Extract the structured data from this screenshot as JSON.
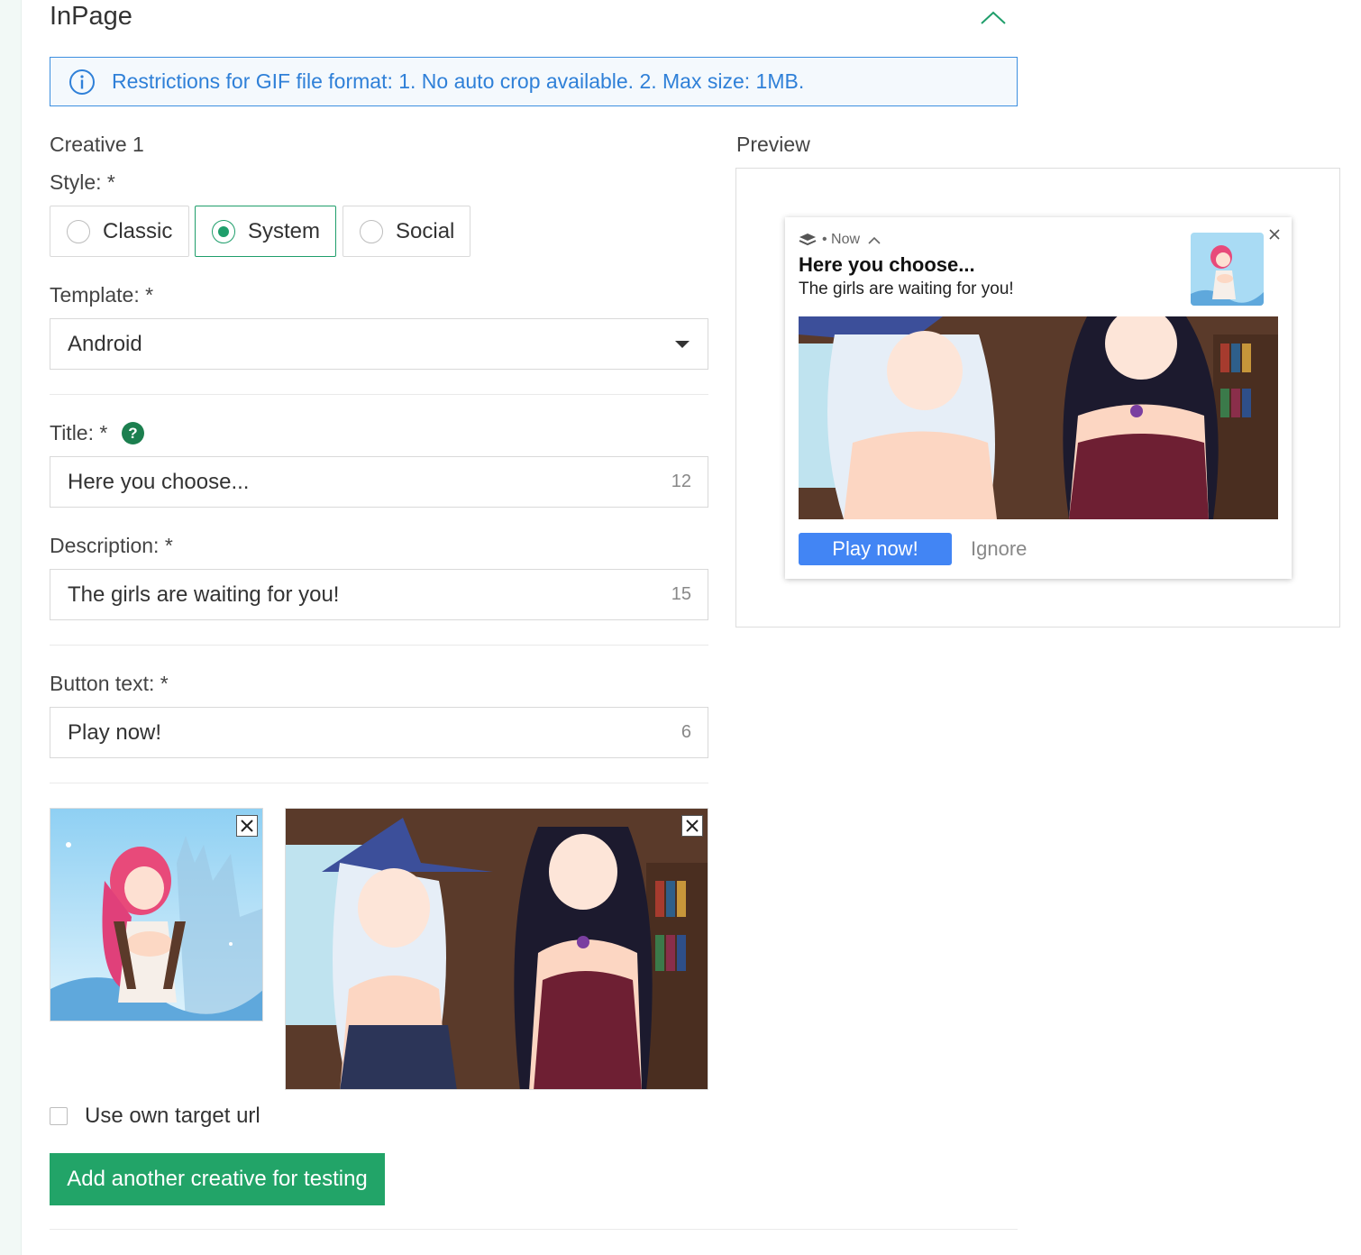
{
  "section": {
    "title": "InPage",
    "collapse_icon": "chevron-up-icon"
  },
  "info": {
    "icon": "info-circle-icon",
    "text": "Restrictions for GIF file format: 1. No auto crop available. 2. Max size: 1MB."
  },
  "creative": {
    "heading": "Creative 1",
    "style": {
      "label": "Style: *",
      "options": [
        {
          "label": "Classic",
          "selected": false
        },
        {
          "label": "System",
          "selected": true
        },
        {
          "label": "Social",
          "selected": false
        }
      ]
    },
    "template": {
      "label": "Template: *",
      "value": "Android"
    },
    "title": {
      "label": "Title: *",
      "help": "?",
      "value": "Here you choose...",
      "count": "12"
    },
    "description": {
      "label": "Description: *",
      "value": "The girls are waiting for you!",
      "count": "15"
    },
    "button_text": {
      "label": "Button text: *",
      "value": "Play now!",
      "count": "6"
    },
    "images": [
      {
        "kind": "icon",
        "description": "pink-haired anime girl on light blue background"
      },
      {
        "kind": "main",
        "description": "two anime witches in a library"
      }
    ],
    "own_url": {
      "label": "Use own target url",
      "checked": false
    },
    "add_button": "Add another creative for testing"
  },
  "preview": {
    "label": "Preview",
    "notification": {
      "time": "• Now",
      "title": "Here you choose...",
      "description": "The girls are waiting for you!",
      "button": "Play now!",
      "ignore": "Ignore"
    }
  },
  "colors": {
    "accent_green": "#22a468",
    "info_blue": "#2f80d8",
    "android_blue": "#4285f4"
  }
}
